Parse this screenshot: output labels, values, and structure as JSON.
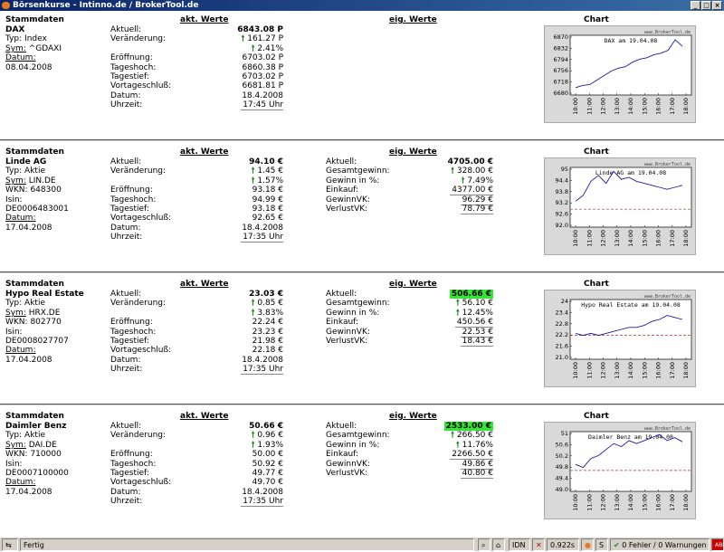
{
  "window": {
    "title": "Börsenkurse - Intinno.de / BrokerTool.de"
  },
  "headers": {
    "stamm": "Stammdaten",
    "akt": "akt. Werte",
    "eig": "eig. Werte",
    "chart": "Chart"
  },
  "labels": {
    "stamm": {
      "typ": "Typ:",
      "sym": "Sym:",
      "wkn": "WKN:",
      "isin": "Isin:",
      "datum": "Datum:"
    },
    "akt": [
      "Aktuell:",
      "Veränderung:",
      "",
      "Eröffnung:",
      "Tageshoch:",
      "Tagestief:",
      "Vortageschluß:",
      "Datum:",
      "Uhrzeit:"
    ],
    "eig": [
      "Aktuell:",
      "Gesamtgewinn:",
      "Gewinn in %:",
      "Einkauf:",
      "GewinnVK:",
      "VerlustVK:"
    ]
  },
  "stocks": [
    {
      "name": "DAX",
      "typ": "Index",
      "sym": "^GDAXI",
      "datum": "08.04.2008",
      "aktuell": "6843.08 P",
      "veraenderung": "161.27 P",
      "veraenderung_pct": "2.41%",
      "eroeffnung": "6703.02 P",
      "tageshoch": "6860.38 P",
      "tagestief": "6703.02 P",
      "vortageschluss": "6681.81 P",
      "datum_akt": "18.4.2008",
      "uhrzeit": "17:45 Uhr",
      "chart_data": {
        "type": "line",
        "title": "DAX am 19.04.08",
        "watermark": "www.BrokerTool.de",
        "x": [
          "10:00",
          "11:00",
          "12:00",
          "13:00",
          "14:00",
          "15:00",
          "16:00",
          "17:00",
          "18:00"
        ],
        "yticks": [
          "6870",
          "6832",
          "6794",
          "6756",
          "6718",
          "6680"
        ],
        "ylim": [
          6680,
          6880
        ],
        "series": [
          {
            "values": [
              6705,
              6712,
              6715,
              6730,
              6745,
              6760,
              6770,
              6775,
              6790,
              6800,
              6805,
              6815,
              6820,
              6830,
              6865,
              6843
            ]
          }
        ]
      }
    },
    {
      "name": "Linde AG",
      "typ": "Aktie",
      "sym": "LIN.DE",
      "wkn": "648300",
      "isin": "DE0006483001",
      "datum": "17.04.2008",
      "aktuell": "94.10 €",
      "veraenderung": "1.45 €",
      "veraenderung_pct": "1.57%",
      "eroeffnung": "93.18 €",
      "tageshoch": "94.99 €",
      "tagestief": "93.18 €",
      "vortageschluss": "92.65 €",
      "datum_akt": "18.4.2008",
      "uhrzeit": "17:35 Uhr",
      "eig_aktuell": "4705.00 €",
      "gesamtgewinn": "328.00 €",
      "gewinn_pct": "7.49%",
      "einkauf": "4377.00 €",
      "gewinnvk": "96.29 €",
      "verlustvk": "78.79 €",
      "chart_data": {
        "type": "line",
        "title": "Linde AG am 19.04.08",
        "watermark": "www.BrokerTool.de",
        "x": [
          "10:00",
          "11:00",
          "12:00",
          "13:00",
          "14:00",
          "15:00",
          "16:00",
          "17:00",
          "18:00"
        ],
        "yticks": [
          "95",
          "94.4",
          "93.8",
          "93.2",
          "92.6",
          "92.0"
        ],
        "ylim": [
          92.0,
          95.0
        ],
        "series": [
          {
            "values": [
              93.3,
              93.6,
              94.3,
              94.6,
              94.2,
              94.8,
              94.4,
              94.5,
              94.3,
              94.2,
              94.1,
              94.0,
              93.9,
              94.0,
              94.1
            ]
          }
        ],
        "reference_line": 92.9
      }
    },
    {
      "name": "Hypo Real Estate",
      "typ": "Aktie",
      "sym": "HRX.DE",
      "wkn": "802770",
      "isin": "DE0008027707",
      "datum": "17.04.2008",
      "aktuell": "23.03 €",
      "veraenderung": "0.85 €",
      "veraenderung_pct": "3.83%",
      "eroeffnung": "22.24 €",
      "tageshoch": "23.23 €",
      "tagestief": "21.98 €",
      "vortageschluss": "22.18 €",
      "datum_akt": "18.4.2008",
      "uhrzeit": "17:35 Uhr",
      "eig_aktuell": "506.66 €",
      "gesamtgewinn": "56.10 €",
      "gewinn_pct": "12.45%",
      "einkauf": "450.56 €",
      "gewinnvk": "22.53 €",
      "verlustvk": "18.43 €",
      "chart_data": {
        "type": "line",
        "title": "Hypo Real Estate am 19.04.08",
        "watermark": "www.BrokerTool.de",
        "x": [
          "10:00",
          "11:00",
          "12:00",
          "13:00",
          "14:00",
          "15:00",
          "16:00",
          "17:00",
          "18:00"
        ],
        "yticks": [
          "24",
          "23.4",
          "22.8",
          "22.2",
          "21.6",
          "21.0"
        ],
        "ylim": [
          21.0,
          24.0
        ],
        "series": [
          {
            "values": [
              22.3,
              22.2,
              22.3,
              22.2,
              22.3,
              22.4,
              22.5,
              22.6,
              22.6,
              22.7,
              22.9,
              23.0,
              23.2,
              23.1,
              23.0
            ]
          }
        ],
        "reference_line": 22.2
      }
    },
    {
      "name": "Daimler Benz",
      "typ": "Aktie",
      "sym": "DAI.DE",
      "wkn": "710000",
      "isin": "DE0007100000",
      "datum": "17.04.2008",
      "aktuell": "50.66 €",
      "veraenderung": "0.96 €",
      "veraenderung_pct": "1.93%",
      "eroeffnung": "50.00 €",
      "tageshoch": "50.92 €",
      "tagestief": "49.77 €",
      "vortageschluss": "49.70 €",
      "datum_akt": "18.4.2008",
      "uhrzeit": "17:35 Uhr",
      "eig_aktuell": "2533.00 €",
      "gesamtgewinn": "266.50 €",
      "gewinn_pct": "11.76%",
      "einkauf": "2266.50 €",
      "gewinnvk": "49.86 €",
      "verlustvk": "40.80 €",
      "chart_data": {
        "type": "line",
        "title": "Daimler Benz am 19.04.08",
        "watermark": "www.BrokerTool.de",
        "x": [
          "10:00",
          "11:00",
          "12:00",
          "13:00",
          "14:00",
          "15:00",
          "16:00",
          "17:00",
          "18:00"
        ],
        "yticks": [
          "51",
          "50.6",
          "50.2",
          "49.8",
          "49.4",
          "49.0"
        ],
        "ylim": [
          49.0,
          51.0
        ],
        "series": [
          {
            "values": [
              49.9,
              49.8,
              50.1,
              50.2,
              50.4,
              50.6,
              50.5,
              50.7,
              50.6,
              50.7,
              50.8,
              50.9,
              50.7,
              50.8,
              50.66
            ]
          }
        ],
        "reference_line": 49.7
      }
    }
  ],
  "status": {
    "text": "Fertig",
    "timing": "0.922s",
    "errors": "0 Fehler / 0 Warnungen",
    "idn": "IDN",
    "adp": "ABP"
  },
  "colors": {
    "hl_green": "#33e633",
    "up_arrow": "#1a8a1a",
    "dax_line": "#1a1aa0",
    "ref_line": "#b03030",
    "teal_line": "#20b0a0"
  }
}
